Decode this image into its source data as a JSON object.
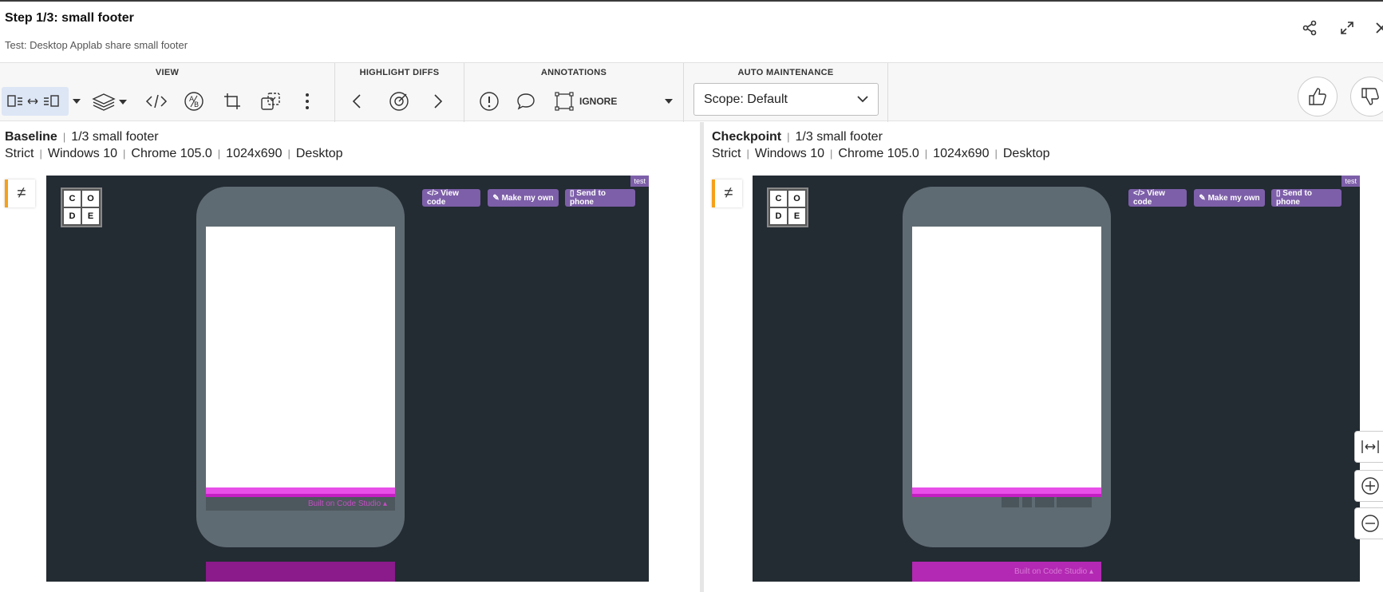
{
  "header": {
    "title": "Step 1/3:  small footer",
    "subtitle": "Test: Desktop Applab share small footer"
  },
  "toolbar": {
    "view_label": "VIEW",
    "highlight_label": "HIGHLIGHT DIFFS",
    "annotations_label": "ANNOTATIONS",
    "ignore_label": "IGNORE",
    "auto_label": "AUTO MAINTENANCE",
    "scope_value": "Scope: Default"
  },
  "baseline": {
    "name": "Baseline",
    "step": "1/3 small footer",
    "mode": "Strict",
    "os": "Windows 10",
    "browser": "Chrome 105.0",
    "size": "1024x690",
    "device": "Desktop"
  },
  "checkpoint": {
    "name": "Checkpoint",
    "step": "1/3 small footer",
    "mode": "Strict",
    "os": "Windows 10",
    "browser": "Chrome 105.0",
    "size": "1024x690",
    "device": "Desktop"
  },
  "app": {
    "logo": [
      "C",
      "O",
      "D",
      "E"
    ],
    "view_code": "</> View code",
    "make_own": "✎ Make my own",
    "send_phone": "▯ Send to phone",
    "test_tag": "test",
    "footer_text": "Built on Code Studio ▴"
  },
  "colors": {
    "accent": "#f5a01a",
    "app_bg": "#232b33",
    "phone": "#5f6b72",
    "pink": "#e84ee8",
    "purple_btn": "#7d5fa9"
  },
  "icons": [
    "share-icon",
    "expand-icon",
    "close-icon",
    "side-by-side-icon",
    "layers-icon",
    "code-icon",
    "ab-icon",
    "crop-icon",
    "compare-icon",
    "more-icon",
    "prev-diff-icon",
    "target-icon",
    "next-diff-icon",
    "issue-icon",
    "comment-icon",
    "ignore-region-icon",
    "thumbs-up-icon",
    "thumbs-down-icon",
    "fit-width-icon",
    "zoom-in-icon",
    "zoom-out-icon",
    "not-equal-icon"
  ]
}
